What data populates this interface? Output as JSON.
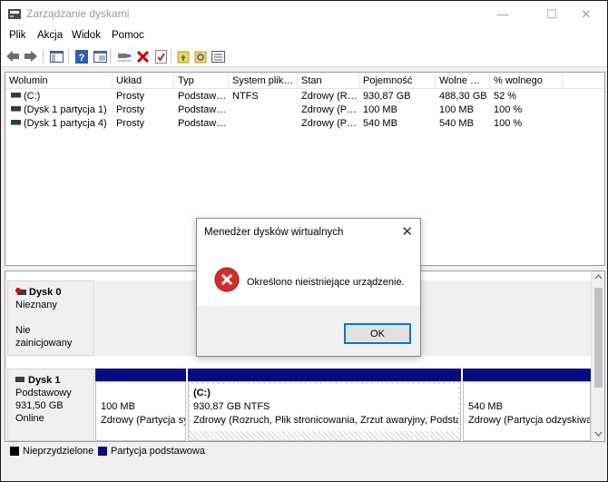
{
  "window": {
    "title": "Zarządzanie dyskami",
    "controls": {
      "minimize": "—",
      "maximize": "☐",
      "close": "✕"
    }
  },
  "menu": [
    "Plik",
    "Akcja",
    "Widok",
    "Pomoc"
  ],
  "toolbar_icons": [
    "back-icon",
    "forward-icon",
    "console-tree-icon",
    "help-icon",
    "properties-icon",
    "connect-icon",
    "delete-icon",
    "check-icon",
    "folder-up-icon",
    "search-folder-icon",
    "list-icon"
  ],
  "volumes": {
    "columns": [
      "Wolumin",
      "Układ",
      "Typ",
      "System plik…",
      "Stan",
      "Pojemność",
      "Wolne …",
      "% wolnego"
    ],
    "rows": [
      [
        "(C:)",
        "Prosty",
        "Podstaw…",
        "NTFS",
        "Zdrowy (R…",
        "930,87 GB",
        "488,30 GB",
        "52 %"
      ],
      [
        "(Dysk 1 partycja 1)",
        "Prosty",
        "Podstaw…",
        "",
        "Zdrowy (P…",
        "100 MB",
        "100 MB",
        "100 %"
      ],
      [
        "(Dysk 1 partycja 4)",
        "Prosty",
        "Podstaw…",
        "",
        "Zdrowy (P…",
        "540 MB",
        "540 MB",
        "100 %"
      ]
    ]
  },
  "disks": {
    "disk0": {
      "name": "Dysk 0",
      "type": "Nieznany",
      "status": "Nie zainicjowany"
    },
    "disk1": {
      "name": "Dysk 1",
      "type": "Podstawowy",
      "size": "931,50 GB",
      "status": "Online",
      "partitions": [
        {
          "title": "",
          "size": "100 MB",
          "status": "Zdrowy (Partycja sy"
        },
        {
          "title": "(C:)",
          "size": "930,87 GB NTFS",
          "status": "Zdrowy (Rozruch, Plik stronicowania, Zrzut awaryjny, Podstaw"
        },
        {
          "title": "",
          "size": "540 MB",
          "status": "Zdrowy (Partycja odzyskiwa"
        }
      ]
    }
  },
  "legend": {
    "unallocated": "Nieprzydzielone",
    "primary": "Partycja podstawowa",
    "colors": {
      "unallocated": "#000000",
      "primary": "#0a0a80"
    }
  },
  "dialog": {
    "title": "Menedżer dysków wirtualnych",
    "message": "Określono nieistniejące urządzenie.",
    "ok_label": "OK",
    "close_glyph": "✕"
  }
}
